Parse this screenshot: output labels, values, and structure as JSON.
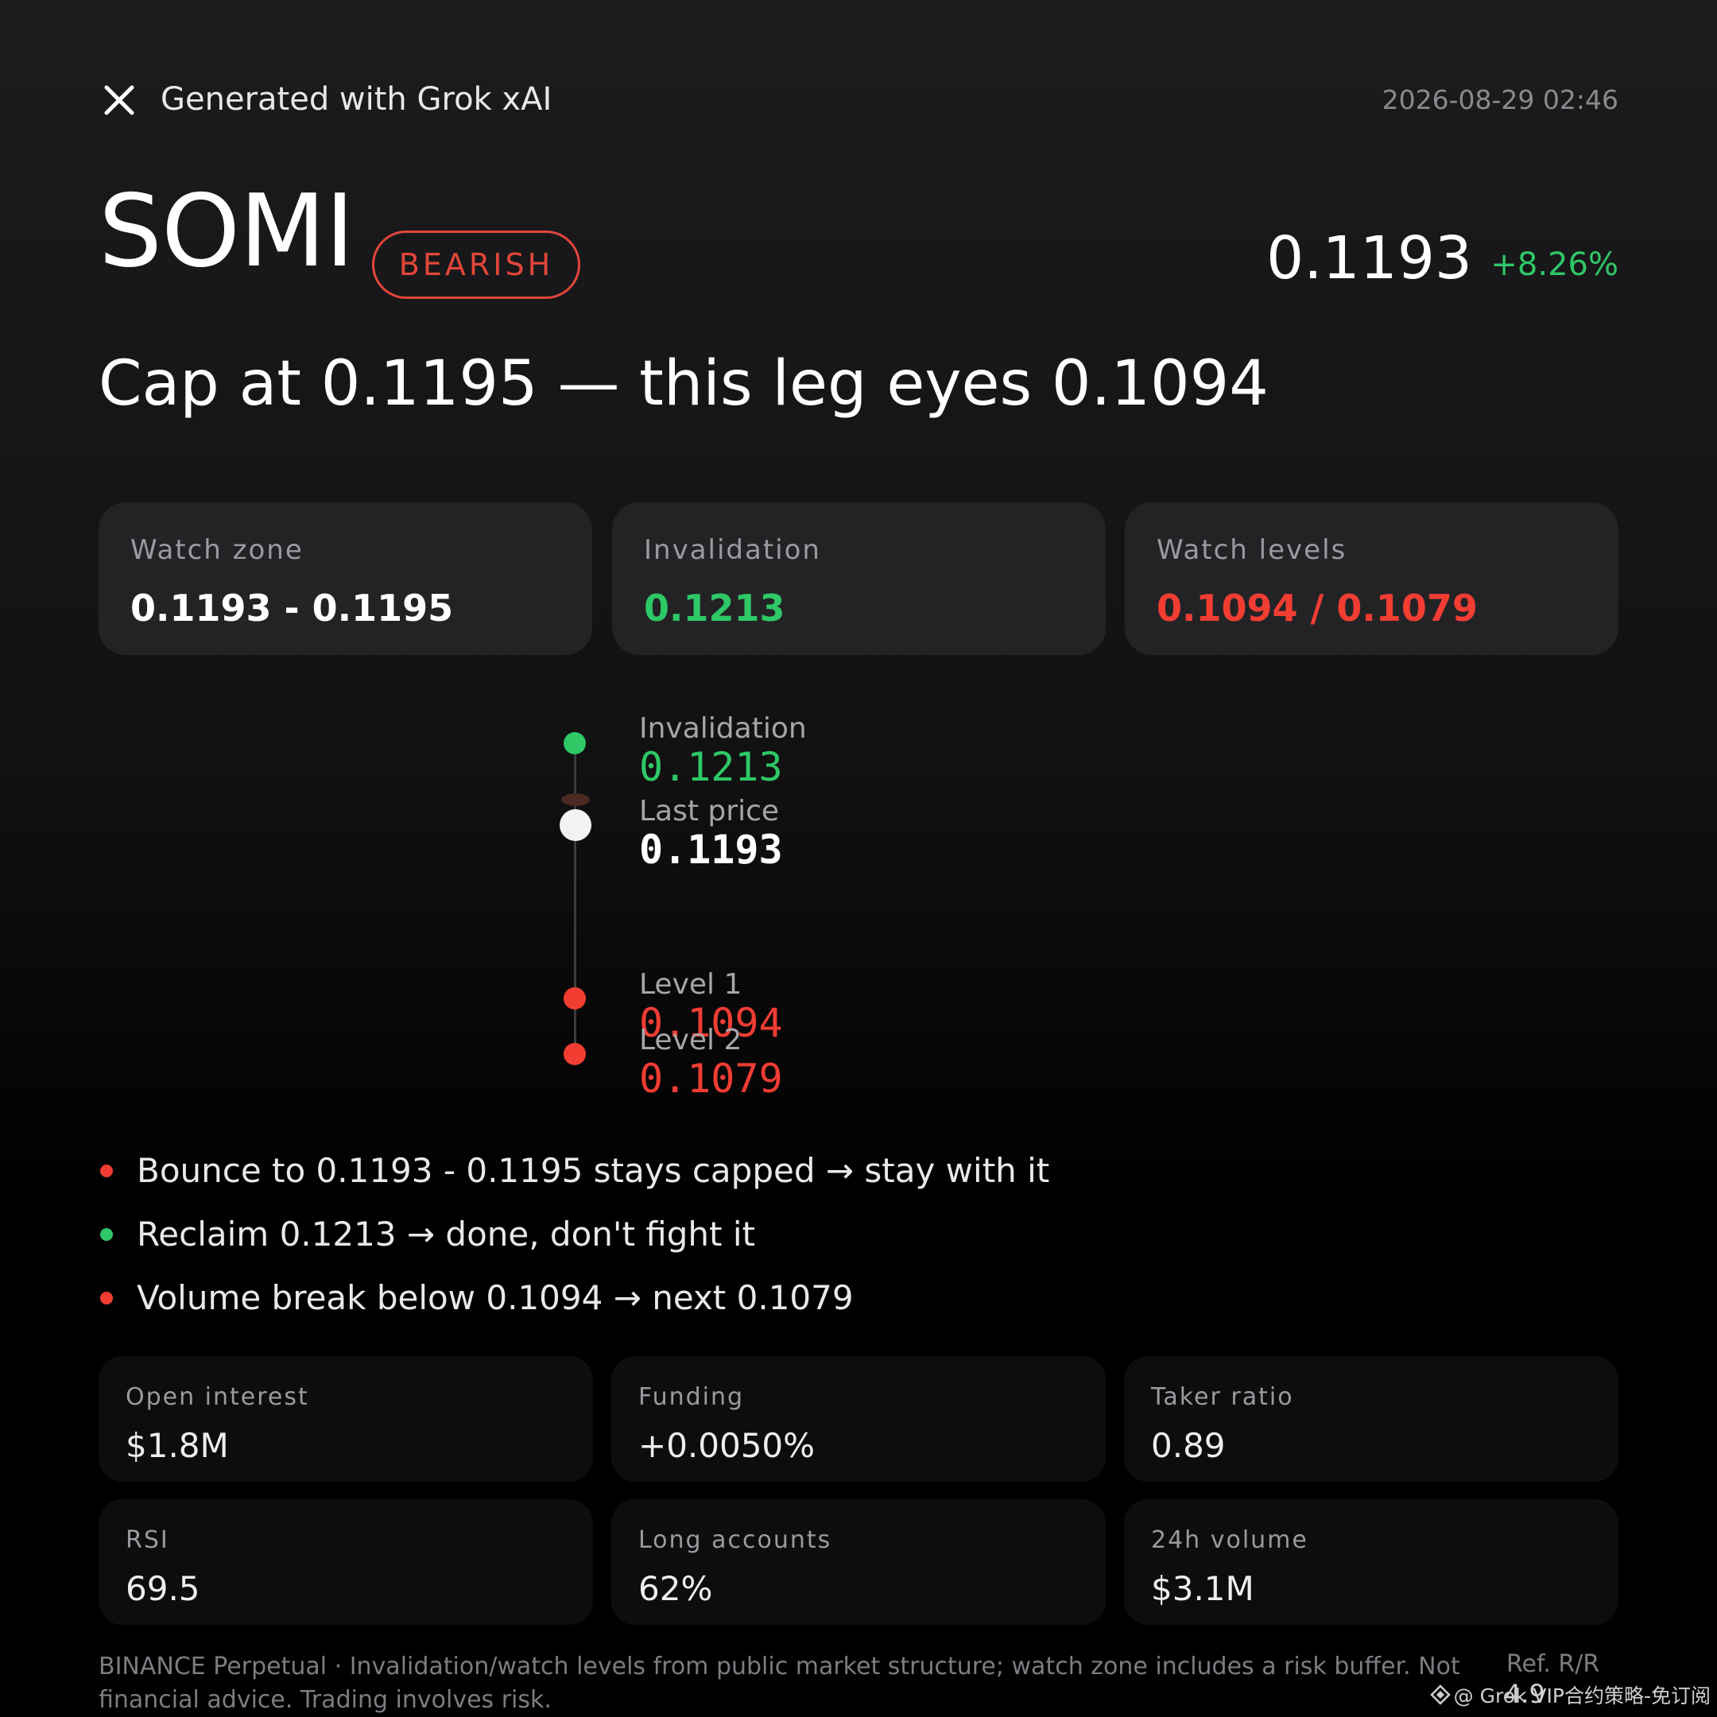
{
  "header": {
    "title": "Generated with Grok xAI",
    "timestamp": "2026-08-29 02:46"
  },
  "ticker": {
    "symbol": "SOMI",
    "badge": "BEARISH",
    "price": "0.1193",
    "change": "+8.26%"
  },
  "headline": "Cap at 0.1195 — this leg eyes 0.1094",
  "cards": [
    {
      "label": "Watch zone",
      "value": "0.1193 - 0.1195",
      "color": "#ffffff"
    },
    {
      "label": "Invalidation",
      "value": "0.1213",
      "color": "#2ec866"
    },
    {
      "label": "Watch levels",
      "value": "0.1094 / 0.1079",
      "color": "#f23d33"
    }
  ],
  "ladder": [
    {
      "label": "Invalidation",
      "value": "0.1213",
      "color": "#2ec866"
    },
    {
      "label": "Last price",
      "value": "0.1193",
      "color": "#ffffff"
    },
    {
      "label": "Level 1",
      "value": "0.1094",
      "color": "#f23d33"
    },
    {
      "label": "Level 2",
      "value": "0.1079",
      "color": "#f23d33"
    }
  ],
  "bullets": [
    {
      "text": "Bounce to 0.1193 - 0.1195 stays capped → stay with it",
      "color": "#f23d33"
    },
    {
      "text": "Reclaim 0.1213 → done, don't fight it",
      "color": "#2ec866"
    },
    {
      "text": "Volume break below 0.1094 → next 0.1079",
      "color": "#f23d33"
    }
  ],
  "stats": [
    {
      "label": "Open interest",
      "value": "$1.8M"
    },
    {
      "label": "Funding",
      "value": "+0.0050%"
    },
    {
      "label": "Taker ratio",
      "value": "0.89"
    },
    {
      "label": "RSI",
      "value": "69.5"
    },
    {
      "label": "Long accounts",
      "value": "62%"
    },
    {
      "label": "24h volume",
      "value": "$3.1M"
    }
  ],
  "footer": {
    "disclaimer": "BINANCE Perpetual · Invalidation/watch levels from public market structure; watch zone includes a risk buffer. Not financial advice. Trading involves risk.",
    "ref_label": "Ref. R/R",
    "ref_value": "4.9",
    "watermark": "@ Grok VIP合约策略-免订阅"
  },
  "colors": {
    "bearish": "#e2463a",
    "green": "#2ec866",
    "red": "#f23d33"
  },
  "icons": {
    "close": "close-icon",
    "watermark": "diamond-logo-icon"
  }
}
